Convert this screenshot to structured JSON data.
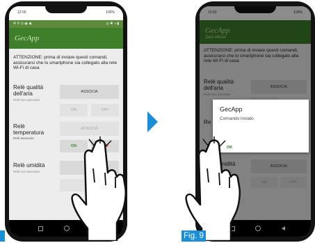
{
  "phone_left": {
    "status_time": "12:00",
    "status_battery": "100%",
    "app_title": "GecApp",
    "warning": "ATTENZIONE: prima di inviare questi comandi, assicurarsi che lo smartphone sia collegato alla rete Wi-Fi di casa",
    "relays": [
      {
        "label": "Relè qualità dell'aria",
        "status": "Relè non associato",
        "associa": "ASSOCIA",
        "on": "ON",
        "off": "OFF"
      },
      {
        "label": "Relè temperatura",
        "status": "Relè associato",
        "associa": "ASSOCIA",
        "on": "ON",
        "off": "OFF"
      },
      {
        "label": "Relè umidità",
        "status": "Relè non associato",
        "associa": "ASSOCIA"
      }
    ]
  },
  "phone_right": {
    "status_time": "12:00",
    "status_battery": "100%",
    "app_title": "GecApp",
    "app_subtitle": "Gecl Alfsos",
    "warning": "ATTENZIONE: prima di inviare questi comandi, assicurarsi che lo smartphone sia collegato alla rete Wi-Fi di casa",
    "relays": [
      {
        "label": "Relè qualità dell'aria",
        "status": "Relè non associato",
        "associa": "ASSOCIA"
      },
      {
        "label": "Relè umidità",
        "associa": "ASSOCIA",
        "on": "ON",
        "off": "OFF"
      }
    ],
    "dialog": {
      "title": "GecApp",
      "message": "Comando inviato",
      "ok": "OK"
    }
  },
  "figure_label": "Fig. 9",
  "colors": {
    "app_green": "#3f7f2c",
    "accent_blue": "#1a8fd8",
    "on_green": "#2e8b2e",
    "off_red": "#dd1111"
  }
}
